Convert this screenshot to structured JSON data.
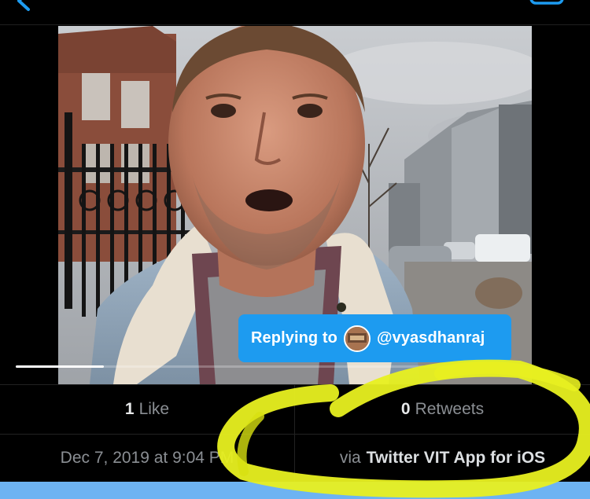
{
  "reply": {
    "prefix": "Replying to",
    "handle": "@vyasdhanraj"
  },
  "video": {
    "progress": 0.2
  },
  "stats": {
    "likes_count": "1",
    "likes_label": "Like",
    "retweets_count": "0",
    "retweets_label": "Retweets",
    "timestamp": "Dec 7, 2019 at 9:04 PM",
    "via_prefix": "via",
    "source_app": "Twitter VIT App for iOS"
  },
  "colors": {
    "accent": "#1d9bf0",
    "highlighter": "#e8f020",
    "background": "#000000",
    "muted_text": "#8b8f94"
  },
  "icons": [
    "back-chevron-icon",
    "compose-icon",
    "play-progress"
  ]
}
